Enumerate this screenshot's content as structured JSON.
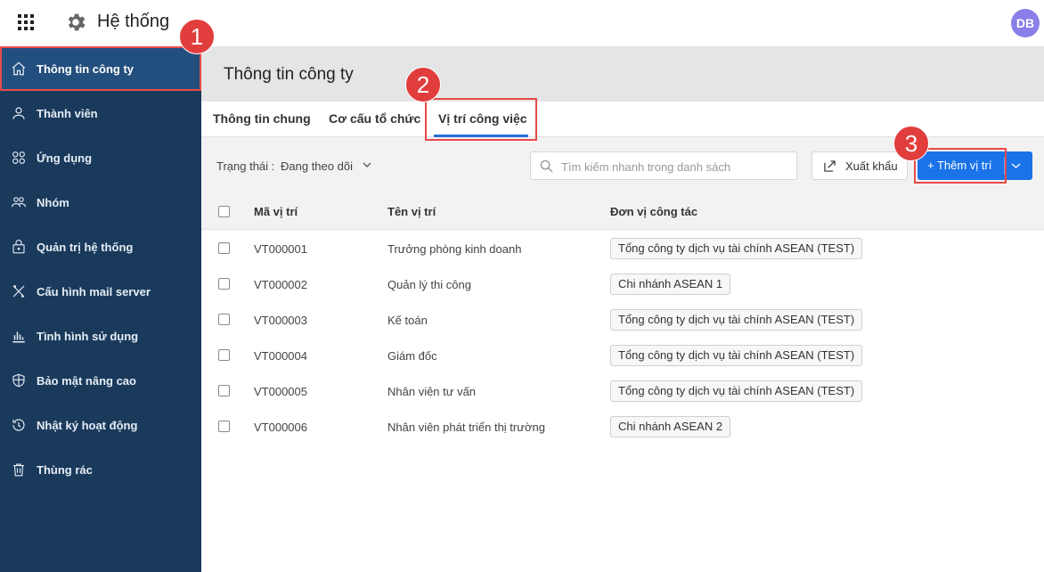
{
  "app": {
    "title": "Hệ thống",
    "avatar_initials": "DB",
    "accent_color": "#1a73e8",
    "sidebar_color": "#1a3a5c",
    "highlight_color": "#e84a4a"
  },
  "sidebar": {
    "items": [
      {
        "label": "Thông tin công ty",
        "icon": "home-icon"
      },
      {
        "label": "Thành viên",
        "icon": "user-icon"
      },
      {
        "label": "Ứng dụng",
        "icon": "apps-circles-icon"
      },
      {
        "label": "Nhóm",
        "icon": "group-icon"
      },
      {
        "label": "Quản trị hệ thống",
        "icon": "admin-icon"
      },
      {
        "label": "Cấu hình mail server",
        "icon": "tools-icon"
      },
      {
        "label": "Tình hình sử dụng",
        "icon": "bar-chart-icon"
      },
      {
        "label": "Bảo mật nâng cao",
        "icon": "shield-icon"
      },
      {
        "label": "Nhật ký hoạt động",
        "icon": "history-icon"
      },
      {
        "label": "Thùng rác",
        "icon": "trash-icon"
      }
    ]
  },
  "main": {
    "page_title": "Thông tin công ty",
    "tabs": [
      {
        "label": "Thông tin chung"
      },
      {
        "label": "Cơ cấu tổ chức"
      },
      {
        "label": "Vị trí công việc"
      }
    ]
  },
  "toolbar": {
    "status_label": "Trạng thái :",
    "status_value": "Đang theo dõi",
    "search_placeholder": "Tìm kiếm nhanh trong danh sách",
    "export_label": "Xuất khẩu",
    "add_label": "+ Thêm vị trí"
  },
  "table": {
    "headers": {
      "code": "Mã vị trí",
      "name": "Tên vị trí",
      "unit": "Đơn vị công tác"
    },
    "rows": [
      {
        "code": "VT000001",
        "name": "Trưởng phòng kinh doanh",
        "unit": "Tổng công ty dịch vụ tài chính ASEAN (TEST)"
      },
      {
        "code": "VT000002",
        "name": "Quản lý thi công",
        "unit": "Chi nhánh ASEAN 1"
      },
      {
        "code": "VT000003",
        "name": "Kế toán",
        "unit": "Tổng công ty dịch vụ tài chính ASEAN (TEST)"
      },
      {
        "code": "VT000004",
        "name": "Giám đốc",
        "unit": "Tổng công ty dịch vụ tài chính ASEAN (TEST)"
      },
      {
        "code": "VT000005",
        "name": "Nhân viên tư vấn",
        "unit": "Tổng công ty dịch vụ tài chính ASEAN (TEST)"
      },
      {
        "code": "VT000006",
        "name": "Nhân viên phát triển thị trường",
        "unit": "Chi nhánh ASEAN 2"
      }
    ]
  },
  "annotations": {
    "step1": "1",
    "step2": "2",
    "step3": "3"
  }
}
